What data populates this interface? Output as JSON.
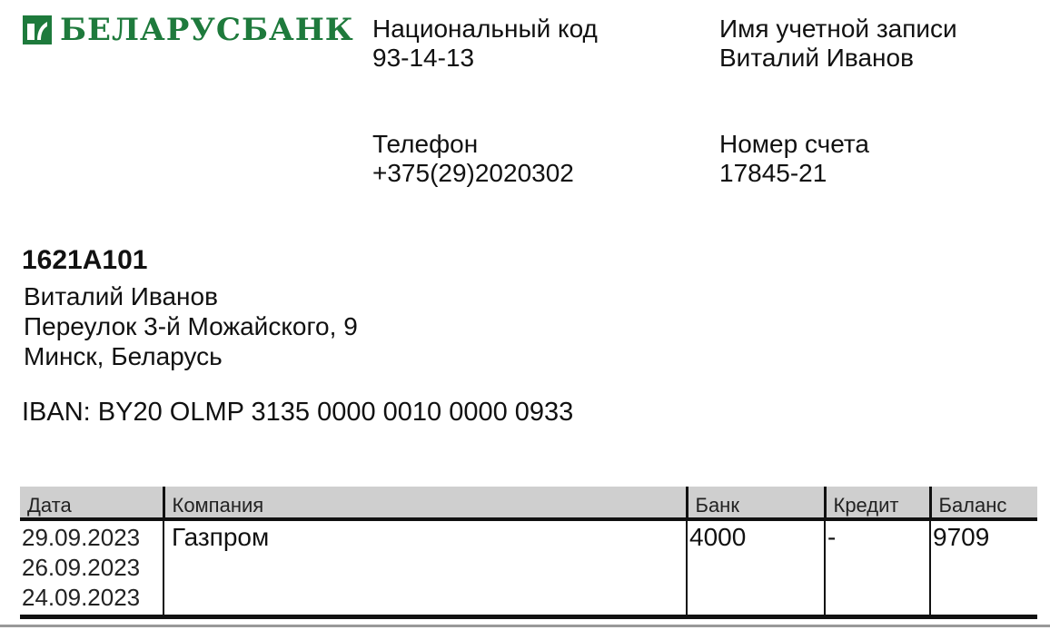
{
  "bank": {
    "name": "БЕЛАРУСБАНК"
  },
  "colors": {
    "brand": "#1e7a3c"
  },
  "header": {
    "national_code": {
      "label": "Национальный код",
      "value": "93-14-13"
    },
    "account_name": {
      "label": "Имя учетной записи",
      "value": "Виталий Иванов"
    },
    "phone": {
      "label": "Телефон",
      "value": "+375(29)2020302"
    },
    "account_number": {
      "label": "Номер счета",
      "value": "17845-21"
    }
  },
  "client": {
    "id": "1621A101",
    "name": "Виталий Иванов",
    "street": "Переулок 3-й Можайского, 9",
    "city": "Минск, Беларусь"
  },
  "iban": "IBAN: BY20 OLMP 3135 0000 0010 0000 0933",
  "table": {
    "headers": [
      "Дата",
      "Компания",
      "Банк",
      "Кредит",
      "Баланс"
    ],
    "dates": [
      "29.09.2023",
      "26.09.2023",
      "24.09.2023"
    ],
    "company": "Газпром",
    "bank": "4000",
    "credit": "-",
    "balance": "9709"
  }
}
